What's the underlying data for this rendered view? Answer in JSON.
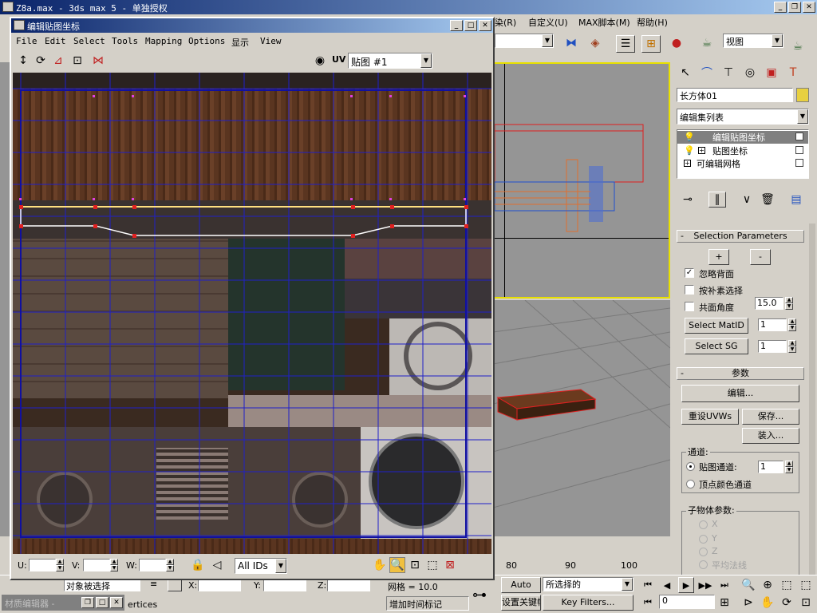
{
  "app": {
    "title": "Z8a.max - 3ds max 5 - 单独授权"
  },
  "menubar": {
    "items_right": [
      "染(R)",
      "自定义(U)",
      "MAX脚本(M)",
      "帮助(H)"
    ]
  },
  "toolbar": {
    "viewport_dropdown": "视图"
  },
  "uv_editor": {
    "title": "编辑贴图坐标",
    "menu": [
      "File",
      "Edit",
      "Select",
      "Tools",
      "Mapping",
      "Options",
      "显示",
      "View"
    ],
    "uv_label": "UV",
    "map_dropdown": "贴图 #1",
    "bottom": {
      "u_label": "U:",
      "v_label": "V:",
      "w_label": "W:",
      "ids_dropdown": "All IDs"
    }
  },
  "command_panel": {
    "object_name": "长方体01",
    "modifier_list": "编辑集列表",
    "stack": [
      "编辑贴图坐标",
      "贴图坐标",
      "可编辑网格"
    ],
    "selection_rollout": {
      "title": "Selection Parameters",
      "plus": "+",
      "minus": "-",
      "ignore_backface": "忽略背面",
      "select_by_element": "按补素选择",
      "planar_angle": "共面角度",
      "planar_value": "15.0",
      "select_matid": "Select MatID",
      "matid_value": "1",
      "select_sg": "Select SG",
      "sg_value": "1"
    },
    "params_rollout": {
      "title": "参数",
      "edit": "编辑...",
      "reset_uvws": "重设UVWs",
      "save": "保存...",
      "load": "装入...",
      "channel_group": "通道:",
      "map_channel": "贴图通道:",
      "map_channel_value": "1",
      "vertex_color": "顶点颜色通道",
      "subobject_group": "子物体参数:",
      "x": "X",
      "y": "Y",
      "z": "Z",
      "average": "平均法线"
    }
  },
  "viewport": {
    "ruler_labels": [
      "80",
      "90",
      "100"
    ]
  },
  "status": {
    "selection": "对象被选择",
    "vertices": "ertices",
    "x": "X:",
    "y": "Y:",
    "z": "Z:",
    "grid": "网格 = 10.0",
    "add_time_tag": "增加时间标记",
    "auto_key": "Auto Key",
    "selected": "所选择的",
    "set_key": "设置关键帧",
    "key_filters": "Key Filters...",
    "frame": "0"
  },
  "material_editor_task": {
    "title": "材质编辑器 -"
  }
}
